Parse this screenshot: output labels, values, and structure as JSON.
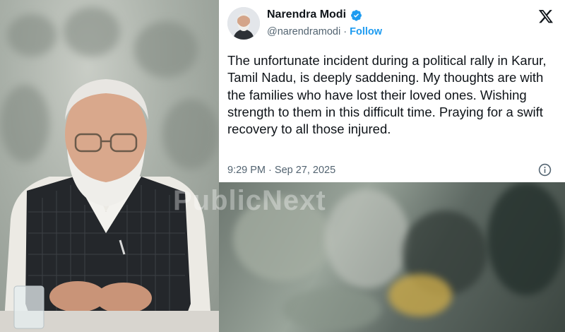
{
  "tweet": {
    "author_name": "Narendra Modi",
    "handle": "@narendramodi",
    "separator": "·",
    "follow_label": "Follow",
    "text": "The unfortunate incident during a political rally in Karur, Tamil Nadu, is deeply saddening. My thoughts are with the families who have lost their loved ones. Wishing strength to them in this difficult time. Praying for a swift recovery to all those injured.",
    "time": "9:29 PM",
    "date": "Sep 27, 2025",
    "verified_icon": "verified-badge-icon",
    "platform_icon": "x-logo-icon",
    "info_icon": "info-icon"
  },
  "watermark": "PublicNext",
  "colors": {
    "link_blue": "#1d9bf0",
    "text_primary": "#0f1419",
    "text_secondary": "#536471"
  }
}
